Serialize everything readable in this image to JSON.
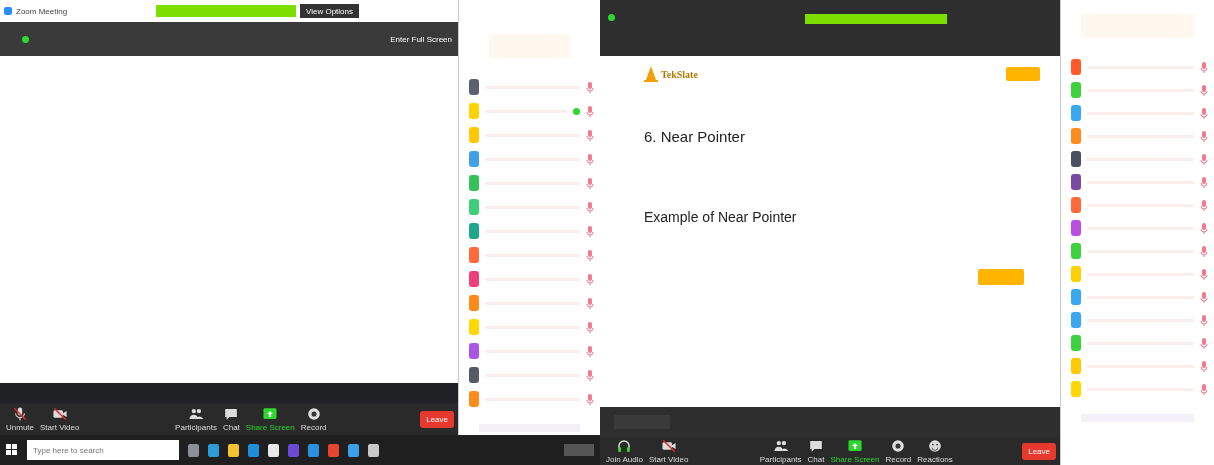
{
  "left_window": {
    "title": "Zoom Meeting",
    "view_options": "View Options",
    "full_screen": "Enter Full Screen",
    "toolbar": [
      {
        "kind": "mic",
        "label": "Unmute",
        "off": true
      },
      {
        "kind": "video",
        "label": "Start Video",
        "off": true
      },
      {
        "kind": "participants",
        "label": "Participants",
        "off": false
      },
      {
        "kind": "chat",
        "label": "Chat",
        "off": false
      },
      {
        "kind": "share",
        "label": "Share Screen",
        "off": false
      },
      {
        "kind": "record",
        "label": "Record",
        "off": false
      }
    ],
    "leave": "Leave"
  },
  "left_participants": [
    {
      "color": "#5a6272",
      "active": false
    },
    {
      "color": "#ffd200",
      "active": true
    },
    {
      "color": "#ffc800",
      "active": false
    },
    {
      "color": "#3fa0e8",
      "active": false
    },
    {
      "color": "#36c25a",
      "active": false
    },
    {
      "color": "#3ccf7a",
      "active": false
    },
    {
      "color": "#1ea88a",
      "active": false
    },
    {
      "color": "#ff6a3c",
      "active": false
    },
    {
      "color": "#f0407a",
      "active": false
    },
    {
      "color": "#ff8a1a",
      "active": false
    },
    {
      "color": "#ffd800",
      "active": false
    },
    {
      "color": "#a855e8",
      "active": false
    },
    {
      "color": "#555a66",
      "active": false
    },
    {
      "color": "#ff8c1a",
      "active": false
    }
  ],
  "taskbar": {
    "search_placeholder": "Type here to search",
    "apps": [
      {
        "color": "#8a8f99"
      },
      {
        "color": "#2e9bd6"
      },
      {
        "color": "#f2c230"
      },
      {
        "color": "#1e8fd8"
      },
      {
        "color": "#e8e8e8"
      },
      {
        "color": "#6a4ad0"
      },
      {
        "color": "#2a90e0"
      },
      {
        "color": "#e8452f"
      },
      {
        "color": "#3aa0e8"
      },
      {
        "color": "#c8c8c8"
      }
    ]
  },
  "right_window": {
    "site_logo": "TekSlate",
    "heading": "6. Near Pointer",
    "subheading": "Example of Near Pointer",
    "toolbar": [
      {
        "kind": "audio",
        "label": "Join Audio",
        "off": false
      },
      {
        "kind": "video",
        "label": "Start Video",
        "off": true
      },
      {
        "kind": "participants",
        "label": "Participants",
        "off": false
      },
      {
        "kind": "chat",
        "label": "Chat",
        "off": false
      },
      {
        "kind": "share",
        "label": "Share Screen",
        "off": false
      },
      {
        "kind": "record",
        "label": "Record",
        "off": false
      },
      {
        "kind": "reactions",
        "label": "Reactions",
        "off": false
      }
    ],
    "leave": "Leave"
  },
  "right_participants": [
    {
      "color": "#ff5a2a"
    },
    {
      "color": "#3dd13d"
    },
    {
      "color": "#3aa8f0"
    },
    {
      "color": "#ff8c1a"
    },
    {
      "color": "#4a5060"
    },
    {
      "color": "#7a4aa0"
    },
    {
      "color": "#ff6a3a"
    },
    {
      "color": "#b850e0"
    },
    {
      "color": "#3dd13d"
    },
    {
      "color": "#ffd000"
    },
    {
      "color": "#3aa8f0"
    },
    {
      "color": "#3aa8f0"
    },
    {
      "color": "#3dd13d"
    },
    {
      "color": "#ffc800"
    },
    {
      "color": "#ffd800"
    }
  ]
}
